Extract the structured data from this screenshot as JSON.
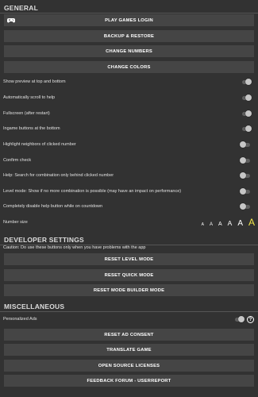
{
  "general": {
    "header": "GENERAL",
    "buttons": [
      "PLAY GAMES LOGIN",
      "BACKUP & RESTORE",
      "CHANGE NUMBERS",
      "CHANGE COLORS"
    ],
    "settings": [
      "Show preview at top and bottom",
      "Automatically scroll to help",
      "Fullscreen (after restart)",
      "Ingame buttons at the bottom",
      "Highlight neighbors of clicked number",
      "Confirm check",
      "Help: Search for combination only behind clicked number",
      "Level mode: Show if no more combination is possible (may have an impact on performance)",
      "Completely disable help button while on countdown"
    ],
    "number_size_label": "Number size",
    "number_size_options": [
      "A",
      "A",
      "A",
      "A",
      "A",
      "A"
    ],
    "number_size_selected_index": 5
  },
  "developer": {
    "header": "DEVELOPER SETTINGS",
    "caution": "Caution: Do use these buttons only when you have problems with the app",
    "buttons": [
      "RESET LEVEL MODE",
      "RESET QUICK MODE",
      "RESET MODE BUILDER MODE"
    ]
  },
  "misc": {
    "header": "MISCELLANEOUS",
    "personalized_ads_label": "Personalized Ads",
    "help_symbol": "?",
    "buttons": [
      "RESET AD CONSENT",
      "TRANSLATE GAME",
      "OPEN SOURCE LICENSES",
      "FEEDBACK FORUM - USERREPORT"
    ]
  },
  "colors": {
    "background": "#323232",
    "button": "#454545",
    "highlight": "#f2e64a"
  }
}
